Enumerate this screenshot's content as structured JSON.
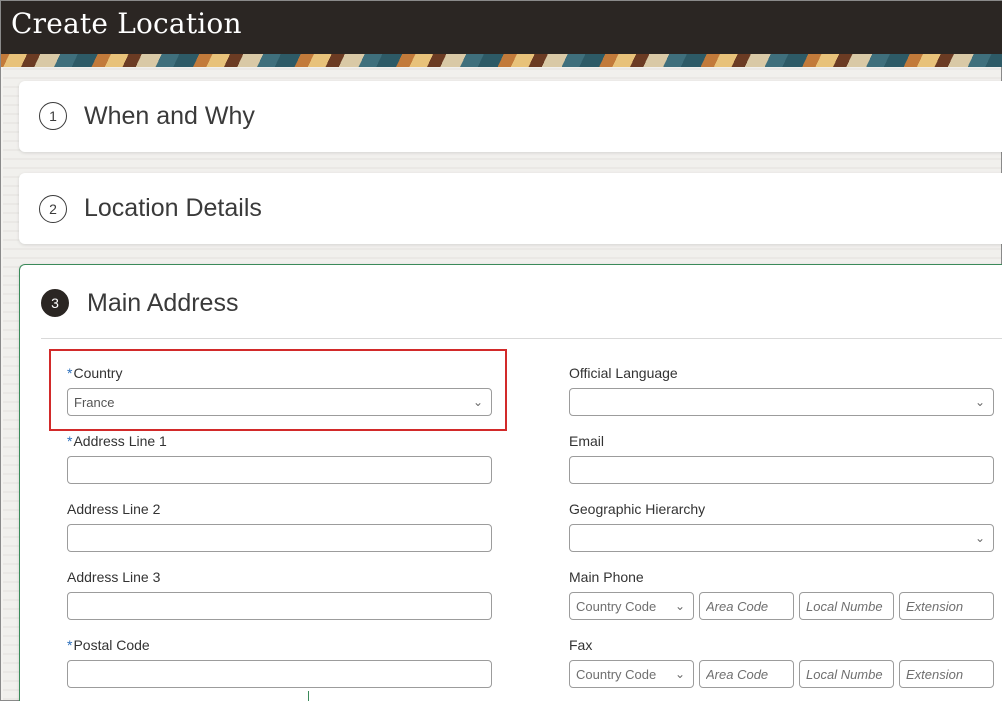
{
  "page": {
    "title": "Create Location"
  },
  "sections": [
    {
      "number": "1",
      "title": "When and Why"
    },
    {
      "number": "2",
      "title": "Location Details"
    },
    {
      "number": "3",
      "title": "Main Address"
    }
  ],
  "left_fields": {
    "country": {
      "label": "Country",
      "value": "France",
      "required": "*"
    },
    "address_line_1": {
      "label": "Address Line 1",
      "required": "*"
    },
    "address_line_2": {
      "label": "Address Line 2"
    },
    "address_line_3": {
      "label": "Address Line 3"
    },
    "postal_code": {
      "label": "Postal Code",
      "required": "*"
    }
  },
  "right_fields": {
    "official_language": {
      "label": "Official Language"
    },
    "email": {
      "label": "Email"
    },
    "geographic_hierarchy": {
      "label": "Geographic Hierarchy"
    },
    "main_phone": {
      "label": "Main Phone",
      "country_code": "Country Code",
      "area_code": "Area Code",
      "local_number": "Local Numbe",
      "extension": "Extension"
    },
    "fax": {
      "label": "Fax",
      "country_code": "Country Code",
      "area_code": "Area Code",
      "local_number": "Local Numbe",
      "extension": "Extension"
    }
  },
  "icons": {
    "dropdown": "chevron-down-icon"
  },
  "colors": {
    "highlight": "#d22a2a",
    "active_section_border": "#3b8a5a",
    "required_marker": "#2a6ebb"
  }
}
